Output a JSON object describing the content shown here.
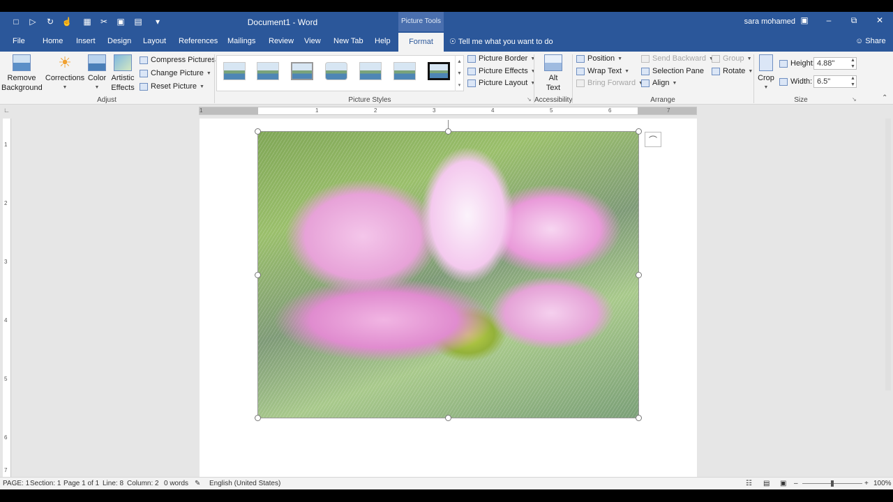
{
  "window": {
    "title": "Document1  -  Word",
    "context_tab_group": "Picture Tools",
    "user": "sara mohamed",
    "accent": "#2b579a"
  },
  "qat_icons": [
    "new-document-icon",
    "open-icon",
    "redo-icon",
    "touch-mode-icon",
    "paste-icon",
    "cut-icon",
    "save-icon",
    "print-preview-icon",
    "customize-qat-icon"
  ],
  "tabs": [
    "File",
    "Home",
    "Insert",
    "Design",
    "Layout",
    "References",
    "Mailings",
    "Review",
    "View",
    "New Tab",
    "Help"
  ],
  "active_tab": "Format",
  "tell_me": "Tell me what you want to do",
  "share": "Share",
  "ribbon": {
    "adjust": {
      "label": "Adjust",
      "remove_background_1": "Remove",
      "remove_background_2": "Background",
      "corrections": "Corrections",
      "color": "Color",
      "artistic_effects_1": "Artistic",
      "artistic_effects_2": "Effects",
      "compress": "Compress Pictures",
      "change": "Change Picture",
      "reset": "Reset Picture"
    },
    "picture_styles": {
      "label": "Picture Styles",
      "picture_border": "Picture Border",
      "picture_effects": "Picture Effects",
      "picture_layout": "Picture Layout"
    },
    "accessibility": {
      "label": "Accessibility",
      "alt_text_1": "Alt",
      "alt_text_2": "Text"
    },
    "arrange": {
      "label": "Arrange",
      "position": "Position",
      "wrap_text": "Wrap Text",
      "bring_forward": "Bring Forward",
      "send_backward": "Send Backward",
      "selection_pane": "Selection Pane",
      "align": "Align",
      "group": "Group",
      "rotate": "Rotate"
    },
    "size": {
      "label": "Size",
      "crop": "Crop",
      "height_label": "Height:",
      "height_value": "4.88\"",
      "width_label": "Width:",
      "width_value": "6.5\""
    }
  },
  "ruler_numbers": [
    "1",
    "1",
    "2",
    "3",
    "4",
    "5",
    "6",
    "7"
  ],
  "vruler_numbers": [
    "1",
    "2",
    "3",
    "4",
    "5",
    "6",
    "7"
  ],
  "status": {
    "page": "PAGE: 1",
    "section": "Section: 1",
    "page_of": "Page 1 of 1",
    "line": "Line: 8",
    "column": "Column: 2",
    "words": "0 words",
    "language": "English (United States)",
    "zoom": "100%",
    "zoom_level": 1.0
  }
}
